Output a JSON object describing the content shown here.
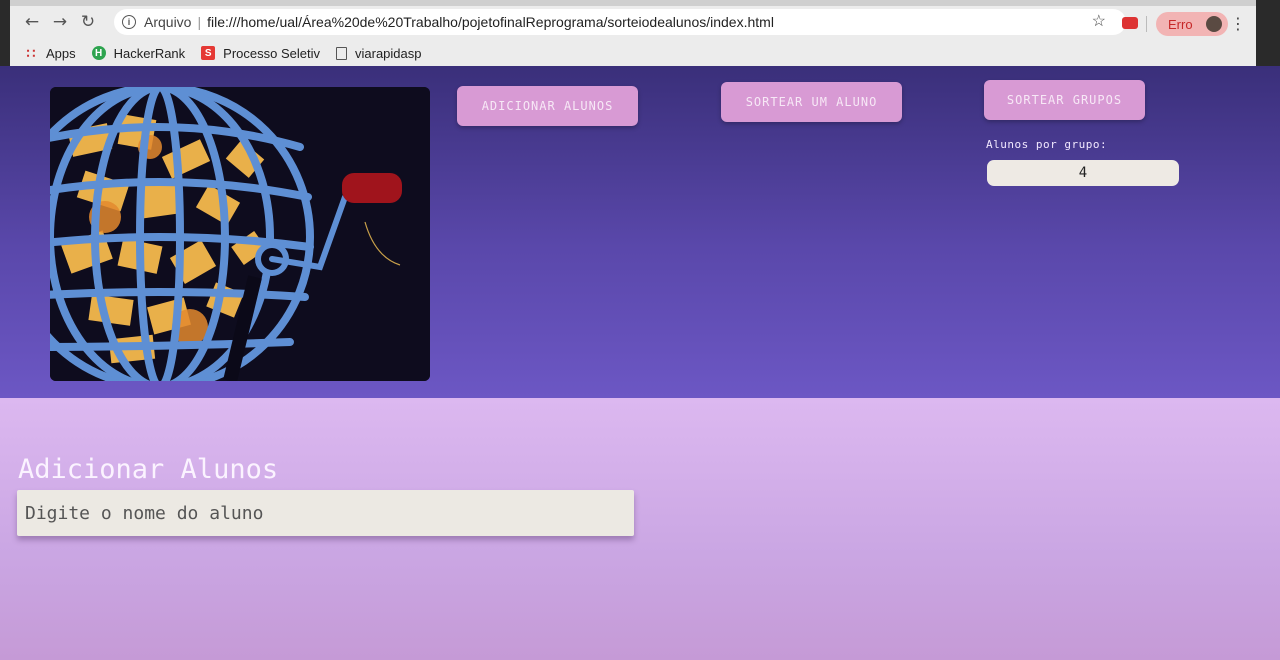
{
  "browser": {
    "security_label": "Arquivo",
    "url": "file:///home/ual/Área%20de%20Trabalho/pojetofinalReprograma/sorteiodealunos/index.html",
    "profile_label": "Erro",
    "bookmarks": [
      {
        "label": "Apps",
        "icon": "apps-grid-icon"
      },
      {
        "label": "HackerRank",
        "icon": "hackerrank-icon"
      },
      {
        "label": "Processo Seletiv",
        "icon": "processo-seletivo-icon"
      },
      {
        "label": "viarapidasp",
        "icon": "page-icon"
      }
    ]
  },
  "app": {
    "buttons": {
      "add_students": "ADICIONAR ALUNOS",
      "draw_one": "SORTEAR UM ALUNO",
      "draw_groups": "SORTEAR GRUPOS"
    },
    "group_size_label": "Alunos por grupo:",
    "group_size_value": "4",
    "add_section_title": "Adicionar Alunos",
    "student_name_placeholder": "Digite o nome do aluno"
  },
  "colors": {
    "hero_top": "#3a2f7a",
    "hero_bottom": "#6c57c4",
    "lower_bg": "#dcb8f0",
    "button_bg": "#d89ad4",
    "input_bg": "#ece9e3"
  }
}
